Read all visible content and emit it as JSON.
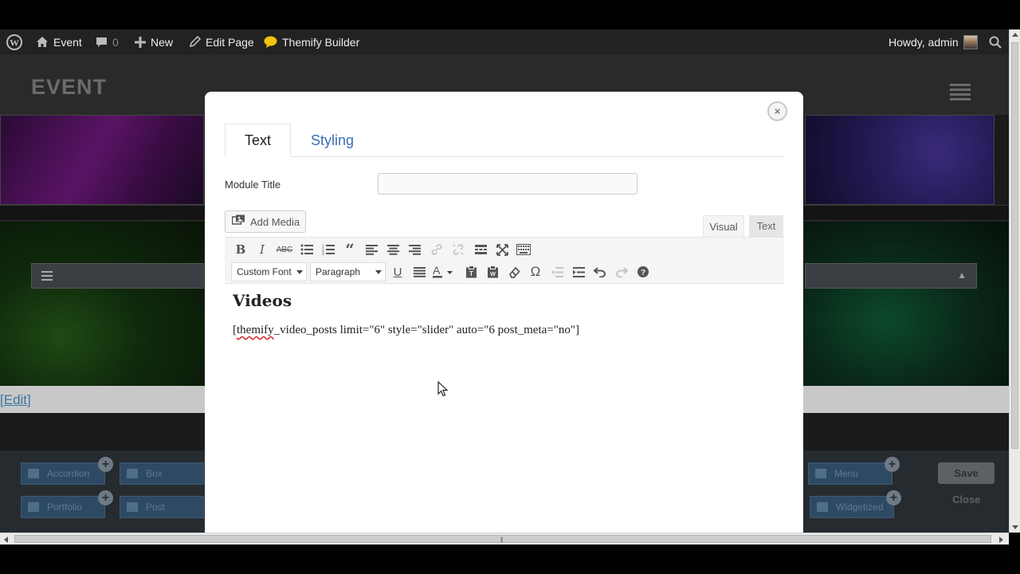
{
  "admin_bar": {
    "wp_logo_icon": "wordpress-logo-icon",
    "site_name": "Event",
    "comments_count": "0",
    "new_label": "New",
    "edit_page_label": "Edit Page",
    "builder_label": "Themify Builder",
    "greeting": "Howdy, admin"
  },
  "site": {
    "logo": "EVENT",
    "edit_bracket_open": "[",
    "edit_label": "Edit",
    "edit_bracket_close": "]"
  },
  "builder_panel": {
    "modules": [
      "Accordion",
      "Box",
      "Portfolio",
      "Post",
      "Menu",
      "Widgetized"
    ],
    "save_label": "Save",
    "close_label": "Close"
  },
  "modal": {
    "close_symbol": "×",
    "tabs": [
      {
        "label": "Text",
        "active": true
      },
      {
        "label": "Styling",
        "active": false
      }
    ],
    "module_title_label": "Module Title",
    "module_title_value": "",
    "add_media_label": "Add Media",
    "editor_modes": [
      {
        "label": "Visual",
        "active": true
      },
      {
        "label": "Text",
        "active": false
      }
    ],
    "toolbar": {
      "font_select": "Custom Font",
      "format_select": "Paragraph",
      "row1_icons": [
        "bold-icon",
        "italic-icon",
        "strikethrough-icon",
        "bullet-list-icon",
        "numbered-list-icon",
        "blockquote-icon",
        "align-left-icon",
        "align-center-icon",
        "align-right-icon",
        "link-icon",
        "unlink-icon",
        "read-more-icon",
        "fullscreen-icon",
        "toolbar-toggle-icon"
      ],
      "row2_icons": [
        "underline-icon",
        "justify-icon",
        "text-color-icon",
        "paste-text-icon",
        "paste-word-icon",
        "clear-formatting-icon",
        "special-character-icon",
        "outdent-icon",
        "indent-icon",
        "undo-icon",
        "redo-icon",
        "help-icon"
      ]
    },
    "editor": {
      "heading": "Videos",
      "shortcode_open": "[",
      "shortcode_misspelled": "themify",
      "shortcode_rest": "_video_posts limit=\"6\" style=\"slider\" auto=\"6 post_meta=\"no\"]"
    }
  },
  "colors": {
    "admin_bar_bg": "#222222",
    "link_blue": "#3b6fb6",
    "overlay_bg": "#1b1b1b"
  }
}
